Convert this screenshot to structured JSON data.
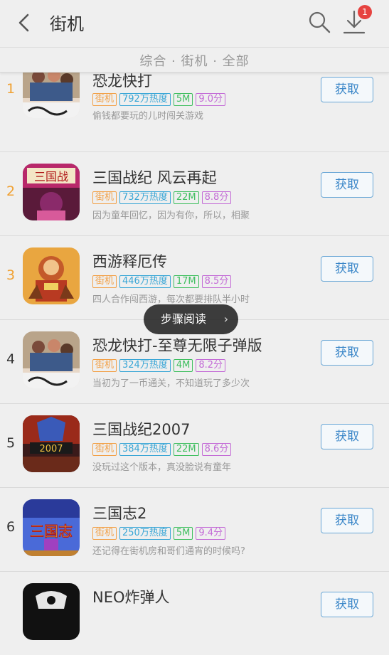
{
  "header": {
    "title": "街机",
    "download_badge": "1"
  },
  "filter": {
    "text": "综合 · 街机 · 全部"
  },
  "toast": {
    "label": "步骤阅读",
    "arrow": "›"
  },
  "apps": [
    {
      "rank": "1",
      "name": "恐龙快打",
      "category": "街机",
      "heat": "792万热度",
      "size": "5M",
      "score": "9.0分",
      "desc": "偷钱都要玩的儿时闯关游戏",
      "button": "获取"
    },
    {
      "rank": "2",
      "name": "三国战纪 风云再起",
      "category": "街机",
      "heat": "732万热度",
      "size": "22M",
      "score": "8.8分",
      "desc": "因为童年回忆，因为有你，所以，相聚",
      "button": "获取"
    },
    {
      "rank": "3",
      "name": "西游释厄传",
      "category": "街机",
      "heat": "446万热度",
      "size": "17M",
      "score": "8.5分",
      "desc": "四人合作闯西游，每次都要排队半小时",
      "button": "获取"
    },
    {
      "rank": "4",
      "name": "恐龙快打-至尊无限子弹版",
      "category": "街机",
      "heat": "324万热度",
      "size": "4M",
      "score": "8.2分",
      "desc": "当初为了一币通关，不知道玩了多少次",
      "button": "获取"
    },
    {
      "rank": "5",
      "name": "三国战纪2007",
      "category": "街机",
      "heat": "384万热度",
      "size": "22M",
      "score": "8.6分",
      "desc": "没玩过这个版本，真没脸说有童年",
      "button": "获取"
    },
    {
      "rank": "6",
      "name": "三国志2",
      "category": "街机",
      "heat": "250万热度",
      "size": "5M",
      "score": "9.4分",
      "desc": "还记得在街机房和哥们通宵的时候吗?",
      "button": "获取"
    },
    {
      "rank": "",
      "name": "NEO炸弹人",
      "category": "",
      "heat": "",
      "size": "",
      "score": "",
      "desc": "",
      "button": "获取"
    }
  ],
  "colors": {
    "rank_top": "#f0a030",
    "button": "#3a86c8",
    "category": "#f2a046",
    "heat": "#39a6d6",
    "size": "#3fbf5f",
    "score": "#c36ad6"
  }
}
